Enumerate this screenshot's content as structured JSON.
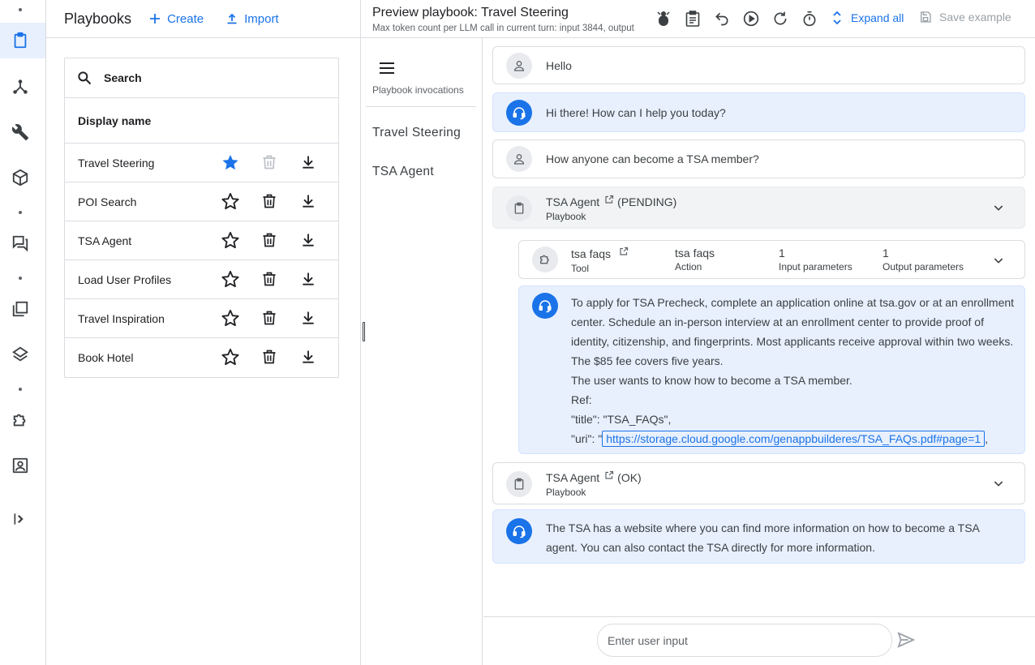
{
  "icons": {
    "nav_rail": [
      "clipboard-icon",
      "flow-icon",
      "wrench-icon",
      "cube-icon",
      "forum-icon",
      "library-icon",
      "layers-icon",
      "extension-icon",
      "account-box-icon",
      "expand-panel-icon"
    ],
    "toolbar": [
      "bug-icon",
      "clipboard-icon",
      "undo-icon",
      "play-icon",
      "reset-icon",
      "timer-icon"
    ]
  },
  "colors": {
    "accent": "#1a73e8",
    "bot_bubble": "#e8f0fe",
    "border": "#dadce0"
  },
  "playbooks": {
    "title": "Playbooks",
    "create_label": "Create",
    "import_label": "Import",
    "search_label": "Search",
    "column_header": "Display name",
    "items": [
      {
        "name": "Travel Steering",
        "starred": true,
        "delete_disabled": true
      },
      {
        "name": "POI Search",
        "starred": false,
        "delete_disabled": false
      },
      {
        "name": "TSA Agent",
        "starred": false,
        "delete_disabled": false
      },
      {
        "name": "Load User Profiles",
        "starred": false,
        "delete_disabled": false
      },
      {
        "name": "Travel Inspiration",
        "starred": false,
        "delete_disabled": false
      },
      {
        "name": "Book Hotel",
        "starred": false,
        "delete_disabled": false
      }
    ]
  },
  "preview": {
    "title": "Preview playbook: Travel Steering",
    "subtitle": "Max token count per LLM call in current turn: input 3844, output",
    "expand_all": "Expand all",
    "save_example": "Save example"
  },
  "invocations": {
    "label": "Playbook invocations",
    "items": [
      "Travel Steering",
      "TSA Agent"
    ]
  },
  "conversation": {
    "user_1": "Hello",
    "bot_1": "Hi there! How can I help you today?",
    "user_2": "How anyone can become a TSA member?",
    "playbook_1": {
      "name": "TSA Agent",
      "status": "(PENDING)",
      "kind": "Playbook"
    },
    "tool_call": {
      "name": "tsa faqs",
      "name_caption": "Tool",
      "action": "tsa faqs",
      "action_caption": "Action",
      "inputs": "1",
      "inputs_caption": "Input parameters",
      "outputs": "1",
      "outputs_caption": "Output parameters"
    },
    "tool_response": {
      "paragraph": "To apply for TSA Precheck, complete an application online at tsa.gov or at an enrollment center. Schedule an in-person interview at an enrollment center to provide proof of identity, citizenship, and fingerprints. Most applicants receive approval within two weeks. The $85 fee covers five years.",
      "summary": "The user wants to know how to become a TSA member.",
      "ref_label": "Ref:",
      "title_line": "\"title\": \"TSA_FAQs\",",
      "uri_prefix": "\"uri\": \"",
      "uri": "https://storage.cloud.google.com/genappbuilderes/TSA_FAQs.pdf#page=1",
      "uri_suffix": ","
    },
    "playbook_2": {
      "name": "TSA Agent",
      "status": "(OK)",
      "kind": "Playbook"
    },
    "bot_2": "The TSA has a website where you can find more information on how to become a TSA agent.  You can also contact the TSA directly for more information."
  },
  "input": {
    "placeholder": "Enter user input"
  }
}
